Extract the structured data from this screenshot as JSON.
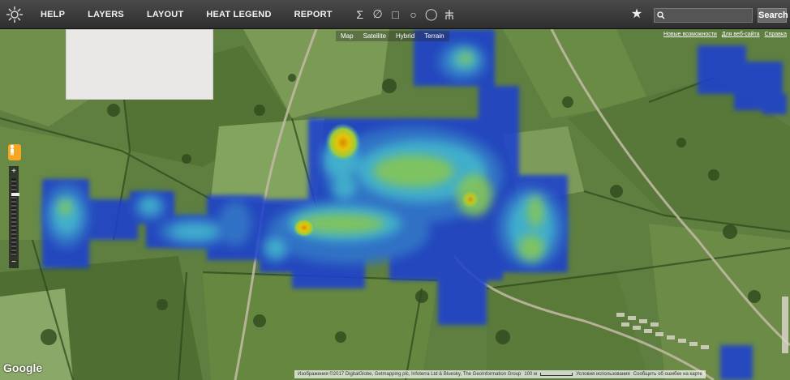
{
  "toolbar": {
    "logo_icon": "sun-logo-icon",
    "menu": [
      "HELP",
      "LAYERS",
      "LAYOUT",
      "HEAT LEGEND",
      "REPORT"
    ],
    "tools": [
      {
        "name": "sum-tool-icon",
        "glyph": "Σ"
      },
      {
        "name": "circle-slash-tool-icon",
        "glyph": "∅"
      },
      {
        "name": "square-tool-icon",
        "glyph": "□"
      },
      {
        "name": "circle-tool-icon",
        "glyph": "○"
      },
      {
        "name": "circle-tool-2-icon",
        "glyph": "◯"
      },
      {
        "name": "tower-tool-icon",
        "glyph": "品"
      }
    ],
    "favorite_icon": "star-icon",
    "search": {
      "value": "",
      "placeholder": "",
      "icon": "search-icon"
    },
    "search_button": "Search"
  },
  "map": {
    "map_types": [
      "Map",
      "Satellite",
      "Hybrid",
      "Terrain"
    ],
    "top_links": [
      "Новые возможности",
      "Для веб-сайта",
      "Справка"
    ],
    "pegman_icon": "pegman-icon",
    "zoom_in": "+",
    "zoom_out": "−",
    "zoom_level": 0.2,
    "google_logo": "Google",
    "attribution": "Изображения ©2017 DigitalGlobe, Getmapping plc, Infoterra Ltd & Bluesky, The GeoInformation Group",
    "scale": "100 м",
    "terms": "Условия использования",
    "report": "Сообщить об ошибке на карте"
  },
  "colors": {
    "heat_low": "#1e3fcf",
    "heat_mid": "#3db5e0",
    "heat_high": "#a6d63a",
    "heat_peak": "#f5b800",
    "satellite_base": "#5b7a3c"
  }
}
